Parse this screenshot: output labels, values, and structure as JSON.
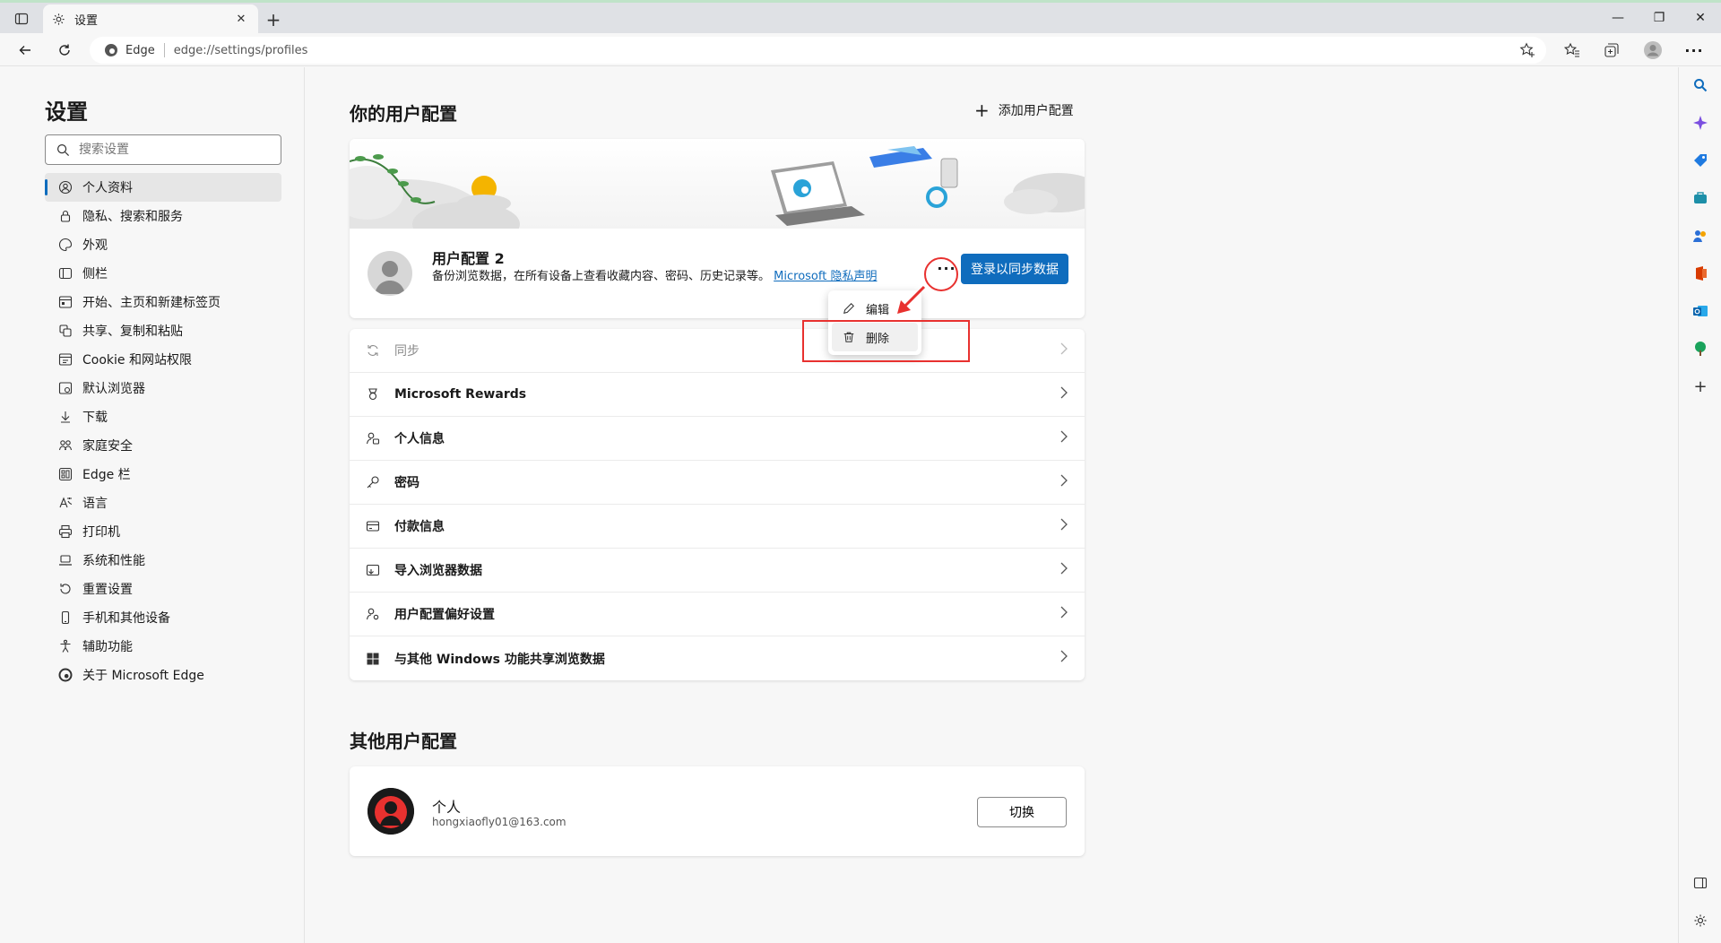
{
  "browser": {
    "tab_title": "设置",
    "site_name": "Edge",
    "url": "edge://settings/profiles"
  },
  "sidebar": {
    "title": "设置",
    "search_placeholder": "搜索设置",
    "items": [
      {
        "label": "个人资料",
        "icon": "profile-icon",
        "active": true
      },
      {
        "label": "隐私、搜索和服务",
        "icon": "lock-icon"
      },
      {
        "label": "外观",
        "icon": "palette-icon"
      },
      {
        "label": "侧栏",
        "icon": "sidebar-icon"
      },
      {
        "label": "开始、主页和新建标签页",
        "icon": "home-grid-icon"
      },
      {
        "label": "共享、复制和粘贴",
        "icon": "share-icon"
      },
      {
        "label": "Cookie 和网站权限",
        "icon": "site-permissions-icon"
      },
      {
        "label": "默认浏览器",
        "icon": "default-browser-icon"
      },
      {
        "label": "下载",
        "icon": "download-icon"
      },
      {
        "label": "家庭安全",
        "icon": "family-icon"
      },
      {
        "label": "Edge 栏",
        "icon": "edge-bar-icon"
      },
      {
        "label": "语言",
        "icon": "language-icon"
      },
      {
        "label": "打印机",
        "icon": "printer-icon"
      },
      {
        "label": "系统和性能",
        "icon": "laptop-icon"
      },
      {
        "label": "重置设置",
        "icon": "reset-icon"
      },
      {
        "label": "手机和其他设备",
        "icon": "phone-icon"
      },
      {
        "label": "辅助功能",
        "icon": "accessibility-icon"
      },
      {
        "label": "关于 Microsoft Edge",
        "icon": "edge-logo-icon"
      }
    ]
  },
  "main": {
    "your_profiles_title": "你的用户配置",
    "add_profile_label": "添加用户配置",
    "profile": {
      "name": "用户配置 2",
      "description": "备份浏览数据，在所有设备上查看收藏内容、密码、历史记录等。",
      "privacy_link": "Microsoft 隐私声明",
      "more_label": "···",
      "signin_label": "登录以同步数据"
    },
    "context_menu": {
      "edit_label": "编辑",
      "delete_label": "删除"
    },
    "settings_rows": [
      {
        "label": "同步",
        "icon": "sync-icon",
        "disabled": true
      },
      {
        "label": "Microsoft Rewards",
        "icon": "rewards-icon"
      },
      {
        "label": "个人信息",
        "icon": "personal-info-icon"
      },
      {
        "label": "密码",
        "icon": "key-icon"
      },
      {
        "label": "付款信息",
        "icon": "card-icon"
      },
      {
        "label": "导入浏览器数据",
        "icon": "import-icon"
      },
      {
        "label": "用户配置偏好设置",
        "icon": "profile-prefs-icon"
      },
      {
        "label": "与其他 Windows 功能共享浏览数据",
        "icon": "windows-icon"
      }
    ],
    "other_profiles_title": "其他用户配置",
    "other_profile": {
      "name": "个人",
      "email": "hongxiaofly01@163.com",
      "switch_label": "切换"
    }
  },
  "colors": {
    "accent": "#0f6cbd",
    "annotation_red": "#e8312f"
  }
}
